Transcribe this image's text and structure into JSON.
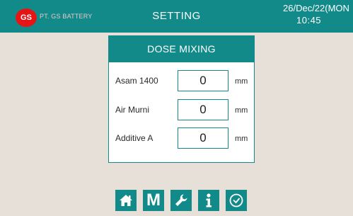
{
  "header": {
    "logo_text": "GS",
    "company": "PT. GS BATTERY",
    "title": "SETTING",
    "date": "26/Dec/22(MON",
    "time": "10:45"
  },
  "panel": {
    "title": "DOSE MIXING",
    "rows": [
      {
        "label": "Asam 1400",
        "value": "0",
        "unit": "mm"
      },
      {
        "label": "Air Murni",
        "value": "0",
        "unit": "mm"
      },
      {
        "label": "Additive A",
        "value": "0",
        "unit": "mm"
      }
    ]
  },
  "nav": {
    "buttons": [
      {
        "icon": "home-icon"
      },
      {
        "icon": "menu-icon",
        "label": "M"
      },
      {
        "icon": "wrench-icon"
      },
      {
        "icon": "info-icon"
      },
      {
        "icon": "clock-icon"
      }
    ]
  },
  "colors": {
    "header": "#138a8a",
    "background": "#e6e0d8",
    "logo": "#e51515"
  }
}
